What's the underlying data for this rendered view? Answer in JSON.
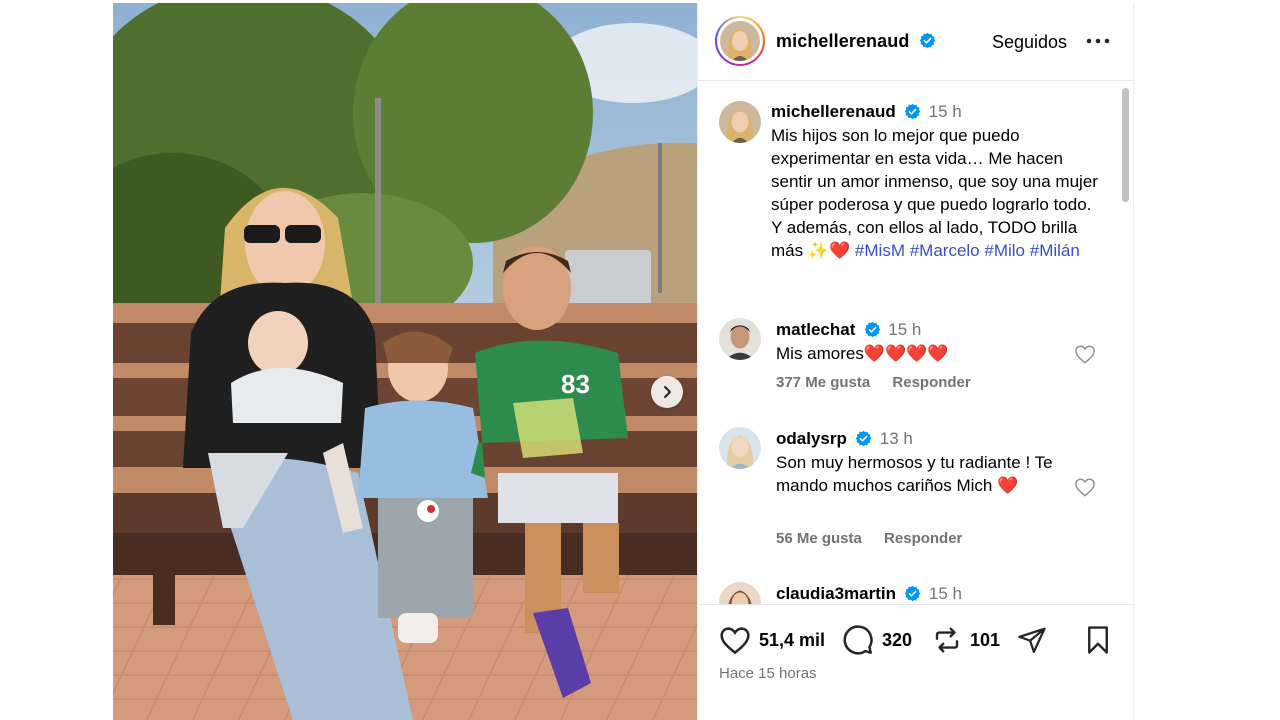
{
  "post": {
    "username": "michellerenaud",
    "follow_status": "Seguidos",
    "caption": {
      "username": "michellerenaud",
      "time": "15 h",
      "text": "Mis hijos son lo mejor que puedo experimentar en esta vida… Me hacen sentir un amor inmenso, que soy una mujer súper poderosa y que puedo lograrlo todo. Y además, con ellos al lado, TODO brilla más ✨❤️",
      "hashtags": [
        "#MisM",
        "#Marcelo",
        "#Milo",
        "#Milán"
      ]
    },
    "comments": [
      {
        "username": "matlechat",
        "time": "15 h",
        "text": "Mis amores❤️❤️❤️❤️",
        "likes": "377 Me gusta",
        "reply": "Responder"
      },
      {
        "username": "odalysrp",
        "time": "13 h",
        "text": "Son muy hermosos y tu radiante ! Te mando muchos cariños Mich ❤️",
        "likes": "56 Me gusta",
        "reply": "Responder"
      },
      {
        "username": "claudia3martin",
        "time": "15 h"
      }
    ],
    "stats": {
      "likes": "51,4 mil",
      "comments": "320",
      "reposts": "101"
    },
    "posted": "Hace 15 horas"
  },
  "icons": {
    "verified": "verified-badge-icon",
    "more": "more-options-icon",
    "like": "heart-icon",
    "comment": "comment-icon",
    "repost": "repost-icon",
    "share": "share-icon",
    "save": "bookmark-icon",
    "next": "chevron-right-icon"
  },
  "colors": {
    "verified": "#0095f6",
    "hashtag": "#3750c9",
    "muted": "#737373"
  }
}
